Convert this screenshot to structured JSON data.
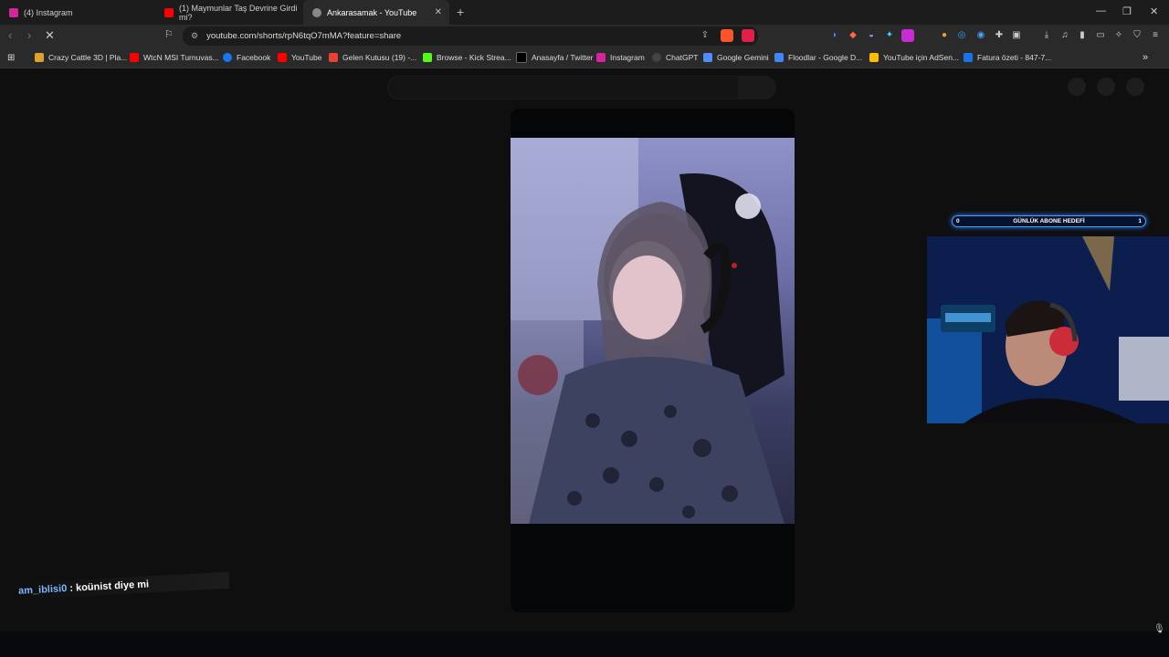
{
  "tabs": [
    {
      "title": "(4) Instagram",
      "color": "#d6249f"
    },
    {
      "title": "(1) Maymunlar Taş Devrine Girdi mi?",
      "color": "#ff0000"
    },
    {
      "title": "Ankarasamak - YouTube",
      "color": "#888888"
    }
  ],
  "address": {
    "url": "youtube.com/shorts/rpN6tqO7mMA?feature=share"
  },
  "bookmarks": [
    {
      "label": "Crazy Cattle 3D | Pla...",
      "color": "#e0a030"
    },
    {
      "label": "WtcN MSI Turnuvas...",
      "color": "#ff0000"
    },
    {
      "label": "Facebook",
      "color": "#1877f2"
    },
    {
      "label": "YouTube",
      "color": "#ff0000"
    },
    {
      "label": "Gelen Kutusu (19) -...",
      "color": "#ea4335"
    },
    {
      "label": "Browse - Kick Strea...",
      "color": "#53fc18"
    },
    {
      "label": "Anasayfa / Twitter",
      "color": "#000000"
    },
    {
      "label": "Instagram",
      "color": "#d6249f"
    },
    {
      "label": "ChatGPT",
      "color": "#444444"
    },
    {
      "label": "Google Gemini",
      "color": "#4e8cff"
    },
    {
      "label": "Floodlar - Google D...",
      "color": "#4285f4"
    },
    {
      "label": "YouTube için AdSen...",
      "color": "#fbbc04"
    },
    {
      "label": "Fatura özeti - 847-7...",
      "color": "#1a73e8"
    }
  ],
  "overlay": {
    "chat_user": "am_iblisi0",
    "chat_message": ": koünist diye mi",
    "goal_label": "GÜNLÜK ABONE HEDEFİ",
    "goal_current": "0",
    "goal_target": "1",
    "goal_progress": 0.0
  }
}
